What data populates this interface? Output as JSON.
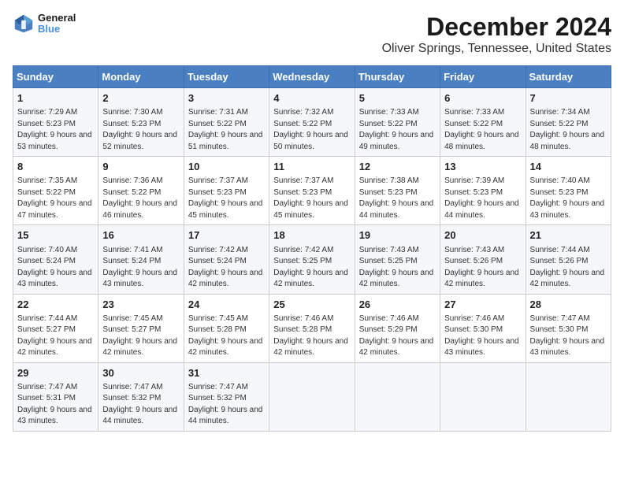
{
  "logo": {
    "line1": "General",
    "line2": "Blue"
  },
  "title": "December 2024",
  "subtitle": "Oliver Springs, Tennessee, United States",
  "days_of_week": [
    "Sunday",
    "Monday",
    "Tuesday",
    "Wednesday",
    "Thursday",
    "Friday",
    "Saturday"
  ],
  "weeks": [
    [
      {
        "day": "1",
        "sunrise": "7:29 AM",
        "sunset": "5:23 PM",
        "daylight": "9 hours and 53 minutes."
      },
      {
        "day": "2",
        "sunrise": "7:30 AM",
        "sunset": "5:23 PM",
        "daylight": "9 hours and 52 minutes."
      },
      {
        "day": "3",
        "sunrise": "7:31 AM",
        "sunset": "5:22 PM",
        "daylight": "9 hours and 51 minutes."
      },
      {
        "day": "4",
        "sunrise": "7:32 AM",
        "sunset": "5:22 PM",
        "daylight": "9 hours and 50 minutes."
      },
      {
        "day": "5",
        "sunrise": "7:33 AM",
        "sunset": "5:22 PM",
        "daylight": "9 hours and 49 minutes."
      },
      {
        "day": "6",
        "sunrise": "7:33 AM",
        "sunset": "5:22 PM",
        "daylight": "9 hours and 48 minutes."
      },
      {
        "day": "7",
        "sunrise": "7:34 AM",
        "sunset": "5:22 PM",
        "daylight": "9 hours and 48 minutes."
      }
    ],
    [
      {
        "day": "8",
        "sunrise": "7:35 AM",
        "sunset": "5:22 PM",
        "daylight": "9 hours and 47 minutes."
      },
      {
        "day": "9",
        "sunrise": "7:36 AM",
        "sunset": "5:22 PM",
        "daylight": "9 hours and 46 minutes."
      },
      {
        "day": "10",
        "sunrise": "7:37 AM",
        "sunset": "5:23 PM",
        "daylight": "9 hours and 45 minutes."
      },
      {
        "day": "11",
        "sunrise": "7:37 AM",
        "sunset": "5:23 PM",
        "daylight": "9 hours and 45 minutes."
      },
      {
        "day": "12",
        "sunrise": "7:38 AM",
        "sunset": "5:23 PM",
        "daylight": "9 hours and 44 minutes."
      },
      {
        "day": "13",
        "sunrise": "7:39 AM",
        "sunset": "5:23 PM",
        "daylight": "9 hours and 44 minutes."
      },
      {
        "day": "14",
        "sunrise": "7:40 AM",
        "sunset": "5:23 PM",
        "daylight": "9 hours and 43 minutes."
      }
    ],
    [
      {
        "day": "15",
        "sunrise": "7:40 AM",
        "sunset": "5:24 PM",
        "daylight": "9 hours and 43 minutes."
      },
      {
        "day": "16",
        "sunrise": "7:41 AM",
        "sunset": "5:24 PM",
        "daylight": "9 hours and 43 minutes."
      },
      {
        "day": "17",
        "sunrise": "7:42 AM",
        "sunset": "5:24 PM",
        "daylight": "9 hours and 42 minutes."
      },
      {
        "day": "18",
        "sunrise": "7:42 AM",
        "sunset": "5:25 PM",
        "daylight": "9 hours and 42 minutes."
      },
      {
        "day": "19",
        "sunrise": "7:43 AM",
        "sunset": "5:25 PM",
        "daylight": "9 hours and 42 minutes."
      },
      {
        "day": "20",
        "sunrise": "7:43 AM",
        "sunset": "5:26 PM",
        "daylight": "9 hours and 42 minutes."
      },
      {
        "day": "21",
        "sunrise": "7:44 AM",
        "sunset": "5:26 PM",
        "daylight": "9 hours and 42 minutes."
      }
    ],
    [
      {
        "day": "22",
        "sunrise": "7:44 AM",
        "sunset": "5:27 PM",
        "daylight": "9 hours and 42 minutes."
      },
      {
        "day": "23",
        "sunrise": "7:45 AM",
        "sunset": "5:27 PM",
        "daylight": "9 hours and 42 minutes."
      },
      {
        "day": "24",
        "sunrise": "7:45 AM",
        "sunset": "5:28 PM",
        "daylight": "9 hours and 42 minutes."
      },
      {
        "day": "25",
        "sunrise": "7:46 AM",
        "sunset": "5:28 PM",
        "daylight": "9 hours and 42 minutes."
      },
      {
        "day": "26",
        "sunrise": "7:46 AM",
        "sunset": "5:29 PM",
        "daylight": "9 hours and 42 minutes."
      },
      {
        "day": "27",
        "sunrise": "7:46 AM",
        "sunset": "5:30 PM",
        "daylight": "9 hours and 43 minutes."
      },
      {
        "day": "28",
        "sunrise": "7:47 AM",
        "sunset": "5:30 PM",
        "daylight": "9 hours and 43 minutes."
      }
    ],
    [
      {
        "day": "29",
        "sunrise": "7:47 AM",
        "sunset": "5:31 PM",
        "daylight": "9 hours and 43 minutes."
      },
      {
        "day": "30",
        "sunrise": "7:47 AM",
        "sunset": "5:32 PM",
        "daylight": "9 hours and 44 minutes."
      },
      {
        "day": "31",
        "sunrise": "7:47 AM",
        "sunset": "5:32 PM",
        "daylight": "9 hours and 44 minutes."
      },
      null,
      null,
      null,
      null
    ]
  ],
  "labels": {
    "sunrise": "Sunrise:",
    "sunset": "Sunset:",
    "daylight": "Daylight:"
  }
}
